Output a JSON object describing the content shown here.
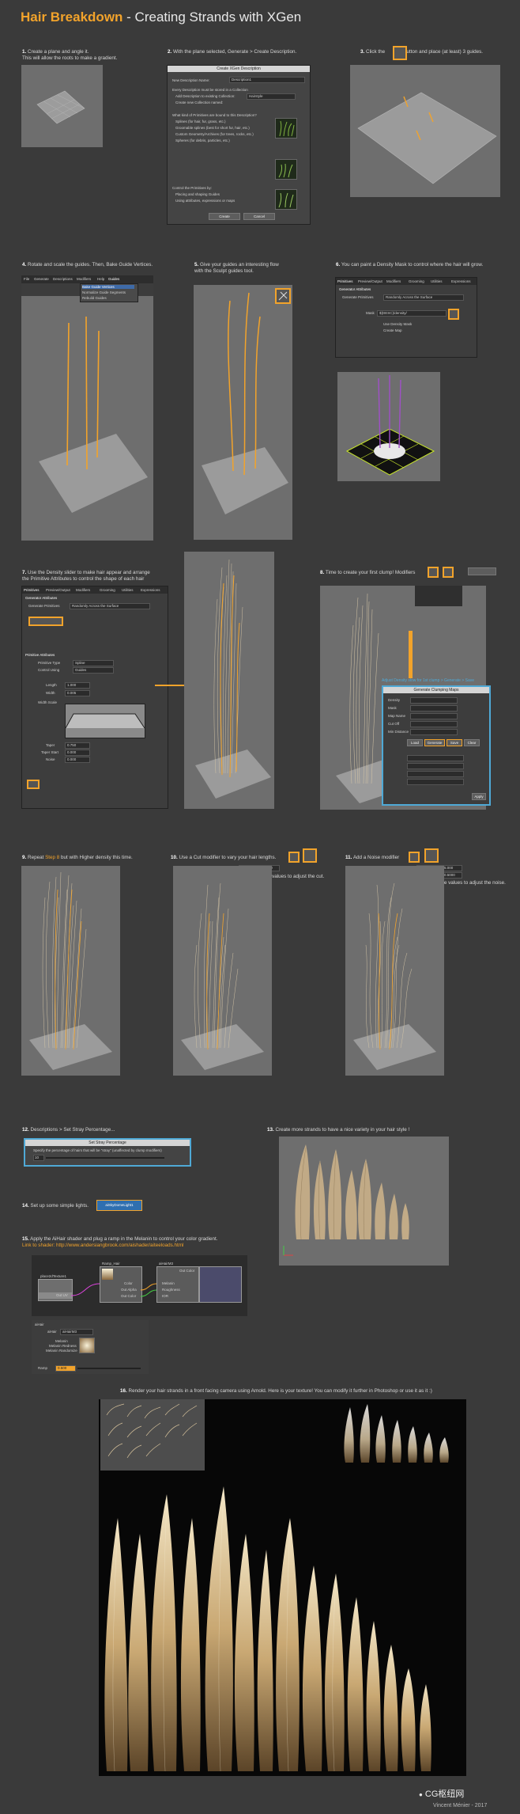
{
  "title": {
    "part1": "Hair Breakdown",
    "part2": " - Creating Strands with XGen"
  },
  "steps": [
    {
      "num": "1.",
      "text": "Create a plane and angle it.",
      "text2": "This will allow the roots to make a gradient."
    },
    {
      "num": "2.",
      "text": "With the plane selected, Generate > Create Description."
    },
    {
      "num": "3.",
      "text_a": "Click the",
      "text_b": "button and place (at least) 3 guides."
    },
    {
      "num": "4.",
      "text": "Rotate and scale the guides. Then, Bake Guide Vertices."
    },
    {
      "num": "5.",
      "text": "Give your guides an interesting flow",
      "text2": "with the Sculpt guides tool."
    },
    {
      "num": "6.",
      "text": "You can paint a Density Mask to control where the hair will grow."
    },
    {
      "num": "7.",
      "text": "Use the Density slider to make hair appear and arrange",
      "text2": "the Primitive Attributes to control the shape of each hair"
    },
    {
      "num": "8.",
      "text": "Time to create your first clump! Modifiers"
    },
    {
      "num": "9.",
      "text_a": "Repeat",
      "text_b": "Step 8",
      "text_c": "but with Higher density this time."
    },
    {
      "num": "10.",
      "text": "Use a Cut modifier to vary your hair lengths.",
      "text2": "Play with these values to adjust the cut."
    },
    {
      "num": "11.",
      "text": "Add a Noise modifier",
      "text2": "Play with these values to adjust the noise."
    },
    {
      "num": "12.",
      "text": "Descriptions > Set Stray Percentage..."
    },
    {
      "num": "13.",
      "text": "Create more strands to have a nice variety in your hair style !"
    },
    {
      "num": "14.",
      "text": "Set up some simple lights."
    },
    {
      "num": "15.",
      "text": "Apply the AiHair shader and plug a ramp in the Melanin to control your color gradient.",
      "text2": "Link to shader: http://www.andersiangbrook.com/aishader/aiteeloads.html"
    },
    {
      "num": "16.",
      "text": "Render your hair strands in a front facing camera using Arnold. Here is your texture! You can modify it further in Photoshop or use it as it :)"
    }
  ],
  "dialog_create": {
    "title": "Create XGen Description",
    "new_desc_label": "New Description Name:",
    "new_desc_value": "Description1",
    "collection_label": "Every Description must be stored in a Collection",
    "opt_add_existing": "Add Description to existing Collection:",
    "opt_create_new": "Create new Collection named:",
    "collection_value": "Hairstyle",
    "q_kind": "What kind of Primitives are bound to this Description?",
    "opt_splines": "Splines (for hair, fur, grass, etc.)",
    "opt_groomable": "Groomable splines (best for short fur, hair, etc.)",
    "opt_custom": "Custom Geometry/Archives (for trees, rocks, etc.)",
    "opt_spheres": "Spheres (for debris, particles, etc.)",
    "q_control": "Control the Primitives by:",
    "opt_guides": "Placing and shaping Guides",
    "opt_attributes": "Using attributes, expressions or maps",
    "btn_create": "Create",
    "btn_cancel": "Cancel"
  },
  "menu": {
    "items": [
      "File",
      "Generate",
      "Descriptions",
      "Modifiers",
      "Help",
      "Guides"
    ],
    "submenu": [
      "Bake Guide Vertices",
      "Normalize Guide Segments",
      "Rebuild Guides"
    ]
  },
  "tabs_panel": [
    "Primitives",
    "Preview/Output",
    "Modifiers",
    "Grooming",
    "Utilities",
    "Expressions"
  ],
  "density_panel": {
    "section": "Generator Attributes",
    "generate_label": "Generate Primitives",
    "generate_value": "Randomly Across the Surface",
    "mask_label": "Mask",
    "mask_value": "${DESC}/density/",
    "use_density": "Use Density Mask",
    "paint_btn": "Paint",
    "ptex_label": "Ptex",
    "ptex_value": "Create Map"
  },
  "prim_panel": {
    "section": "Primitive Attributes",
    "rows": [
      {
        "label": "Primitive Type",
        "value": "Spline"
      },
      {
        "label": "Control Using",
        "value": "Guides"
      },
      {
        "label": "Length",
        "value": "1.000"
      },
      {
        "label": "Width",
        "value": "0.005"
      },
      {
        "label": "Width Scale",
        "value": ""
      },
      {
        "label": "Taper",
        "value": "0.750"
      },
      {
        "label": "Taper Start",
        "value": "0.000"
      },
      {
        "label": "Noise",
        "value": "0.000"
      },
      {
        "label": "Density",
        "value": "6.000"
      }
    ]
  },
  "clump_panel": {
    "title": "Adjust Density slow for 1st clump > Generate > Save",
    "window": "Generate Clumping Maps",
    "rows": [
      "Density",
      "Mask",
      "Map Name",
      "Cut Off",
      "Min Distance"
    ],
    "buttons": [
      "Load",
      "Generate",
      "Save",
      "Clear"
    ],
    "apply": "Apply"
  },
  "cut_panel": {
    "label": "Amount",
    "value": "0.0000"
  },
  "noise_panel": {
    "label1": "Frequency",
    "value1": "5.000",
    "label2": "Magnitude",
    "value2": "0.5000"
  },
  "stray_dialog": {
    "title": "Set Stray Percentage",
    "text": "Specify the percentage of hairs that will be \"stray\" (unaffected by clump modifiers)",
    "value": "10"
  },
  "light_chip": {
    "text": "aiSkyDomeLight1"
  },
  "shader_nodes": [
    {
      "name": "place2dTexture1"
    },
    {
      "name": "Ramp_Hair"
    },
    {
      "name": "aiHairM3"
    }
  ],
  "shader_ports": {
    "ramp": [
      "Color",
      "Out Alpha",
      "Out Color"
    ],
    "hair": [
      "Melanin",
      "Roughness",
      "IOR",
      "Out Color"
    ],
    "place": [
      "Out UV"
    ]
  },
  "shader_attr": {
    "name_label": "aiHair",
    "tab": "aiHairM3",
    "shader_label": "Shader",
    "fields": [
      "Melanin",
      "Melanin Redness",
      "Melanin Randomize"
    ],
    "ramp_label": "Ramp",
    "ramp_value": "0.500"
  },
  "credit": "Vincent Ménier - 2017",
  "watermark": "CG枢纽网",
  "colors": {
    "accent": "#f2a32b",
    "bg": "#3a3a3a",
    "guide": "#f2a32b",
    "hair": "#c9b089",
    "mask_purple": "#a050c8",
    "mask_green": "#c8e62a"
  }
}
